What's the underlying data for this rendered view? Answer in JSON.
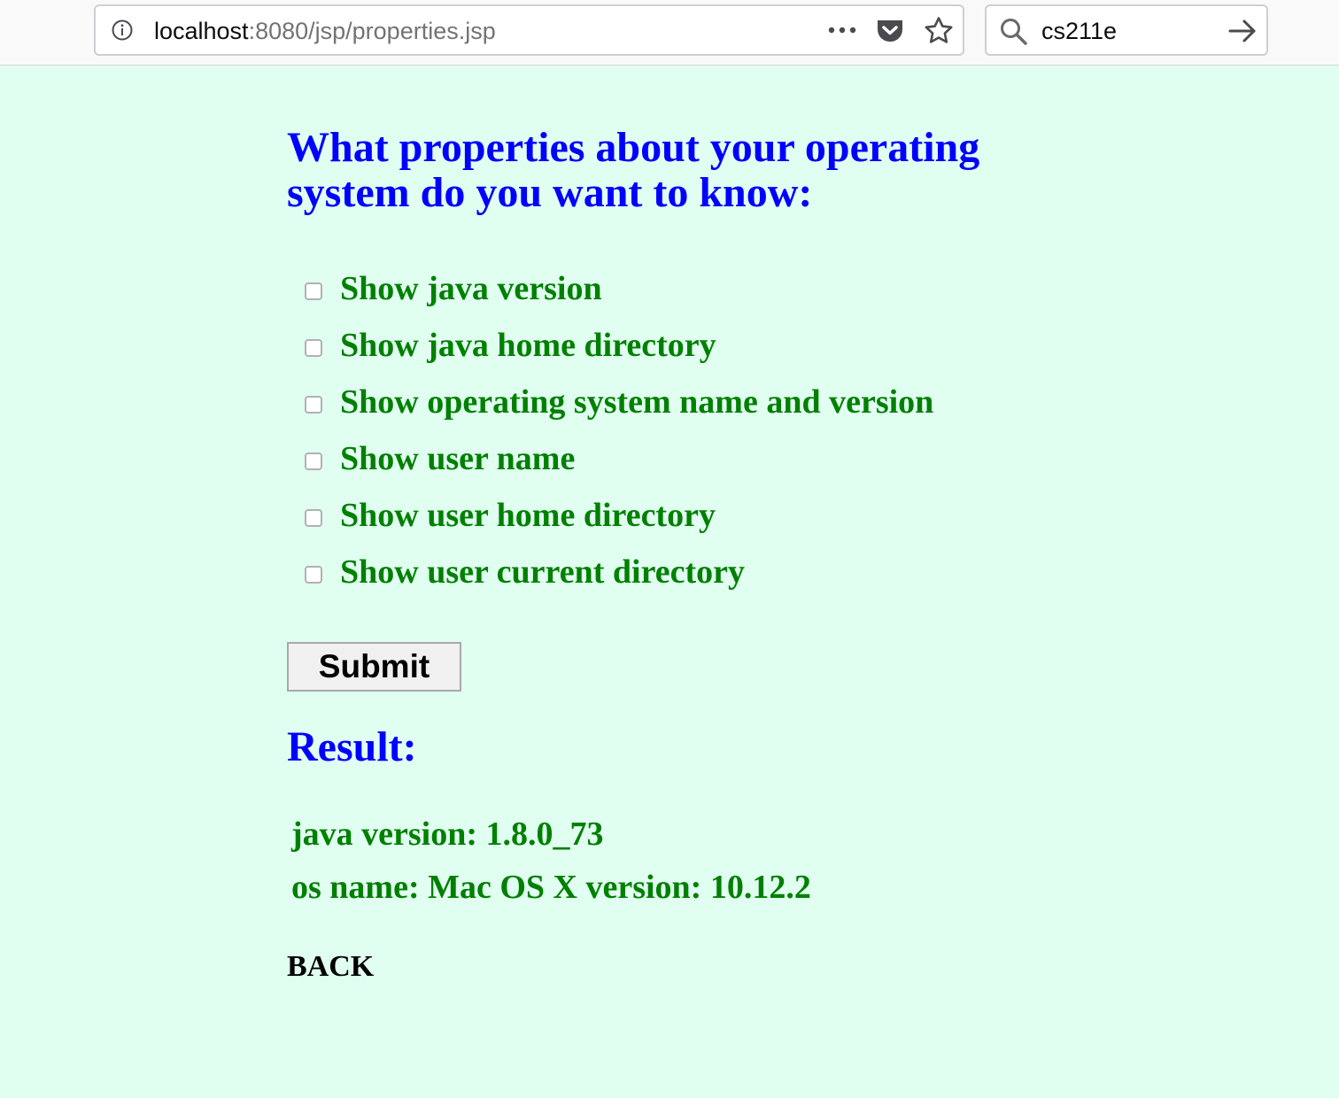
{
  "browser": {
    "url_host": "localhost",
    "url_rest": ":8080/jsp/properties.jsp",
    "search_text": "cs211e",
    "icons": {
      "info": "info-icon",
      "page_actions": "dots-icon",
      "pocket": "pocket-icon",
      "bookmark": "star-icon",
      "search": "search-icon",
      "go": "arrow-right-icon"
    }
  },
  "page": {
    "title": "What properties about your operating system do you want to know:",
    "options": [
      {
        "label": "Show java version",
        "checked": false
      },
      {
        "label": "Show java home directory",
        "checked": false
      },
      {
        "label": "Show operating system name and version",
        "checked": false
      },
      {
        "label": "Show user name",
        "checked": false
      },
      {
        "label": "Show user home directory",
        "checked": false
      },
      {
        "label": "Show user current directory",
        "checked": false
      }
    ],
    "submit_label": "Submit",
    "result_heading": "Result:",
    "results": [
      "java version: 1.8.0_73",
      "os name: Mac OS X version: 10.12.2"
    ],
    "back_label": "BACK"
  },
  "colors": {
    "background": "#e1fff1",
    "heading": "#0000ff",
    "text_green": "#008000"
  }
}
